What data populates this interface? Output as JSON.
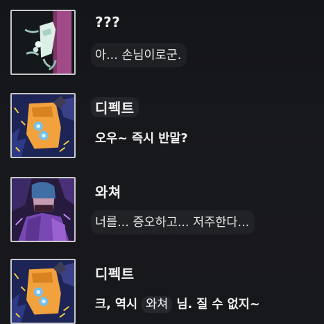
{
  "messages": [
    {
      "sender": "???",
      "text": "아... 손님이로군.",
      "avatar": "pink-hat-ghost-avatar"
    },
    {
      "sender": "디펙트",
      "text": "오우~ 즉시 반말?",
      "avatar": "orange-robot-avatar"
    },
    {
      "sender": "와쳐",
      "text": "너를... 증오하고... 저주한다...",
      "avatar": "purple-masked-figure-avatar"
    },
    {
      "sender": "디펙트",
      "text_before": "크, 역시",
      "text_highlight": "와쳐",
      "text_after": "님. 질 수 없지~",
      "avatar": "orange-robot-avatar"
    }
  ],
  "colors": {
    "background": "#16171b",
    "text": "#f2f2f2",
    "avatar_border": "#c9c9cb"
  }
}
